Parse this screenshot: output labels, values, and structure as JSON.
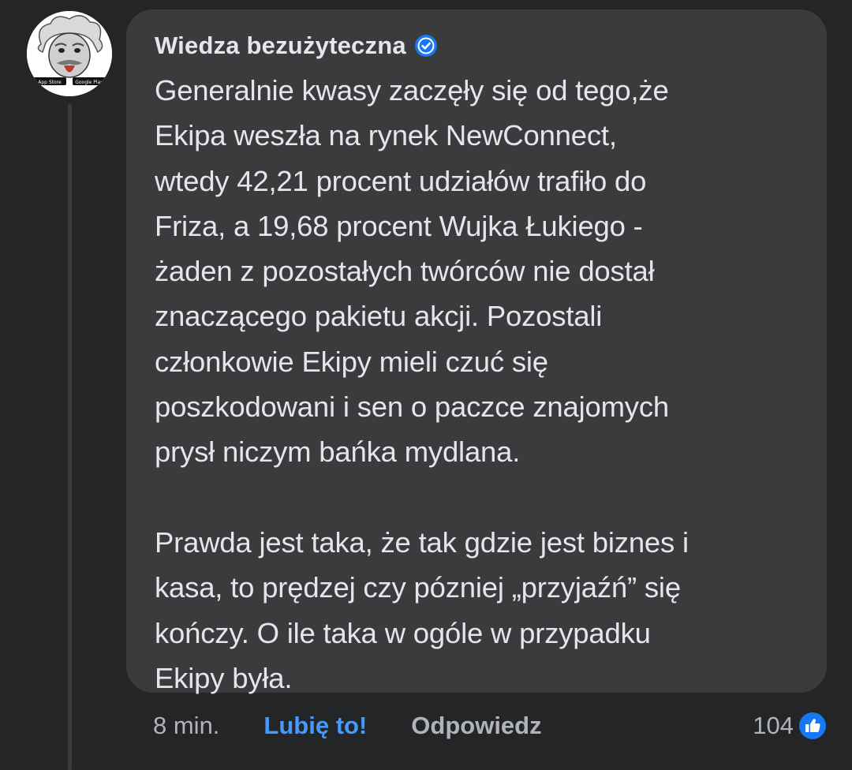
{
  "comment": {
    "author": "Wiedza bezużyteczna",
    "verified": true,
    "text": "Generalnie kwasy zaczęły się od tego,że\nEkipa weszła na rynek NewConnect,\nwtedy 42,21 procent udziałów trafiło do\nFriza, a 19,68 procent Wujka Łukiego -\nżaden z pozostałych twórców nie dostał\nznaczącego pakietu akcji. Pozostali\nczłonkowie Ekipy mieli czuć się\nposzkodowani i sen o paczce znajomych\nprysł niczym bańka mydlana.\n\nPrawda jest taka, że tak gdzie jest biznes i\nkasa, to prędzej czy pózniej „przyjaźń” się\nkończy. O ile taka w ogóle w przypadku\nEkipy była."
  },
  "avatar": {
    "store_badges": [
      "App Store",
      "Google Play"
    ]
  },
  "actions": {
    "timestamp": "8 min.",
    "like_label": "Lubię to!",
    "reply_label": "Odpowiedz"
  },
  "reactions": {
    "count": "104",
    "icon": "thumbs-up-icon"
  },
  "colors": {
    "background": "#242526",
    "bubble": "#3a3b3c",
    "text": "#e4e6eb",
    "muted": "#b0b3b8",
    "like_blue": "#4599ff",
    "badge_blue": "#1877f2"
  }
}
